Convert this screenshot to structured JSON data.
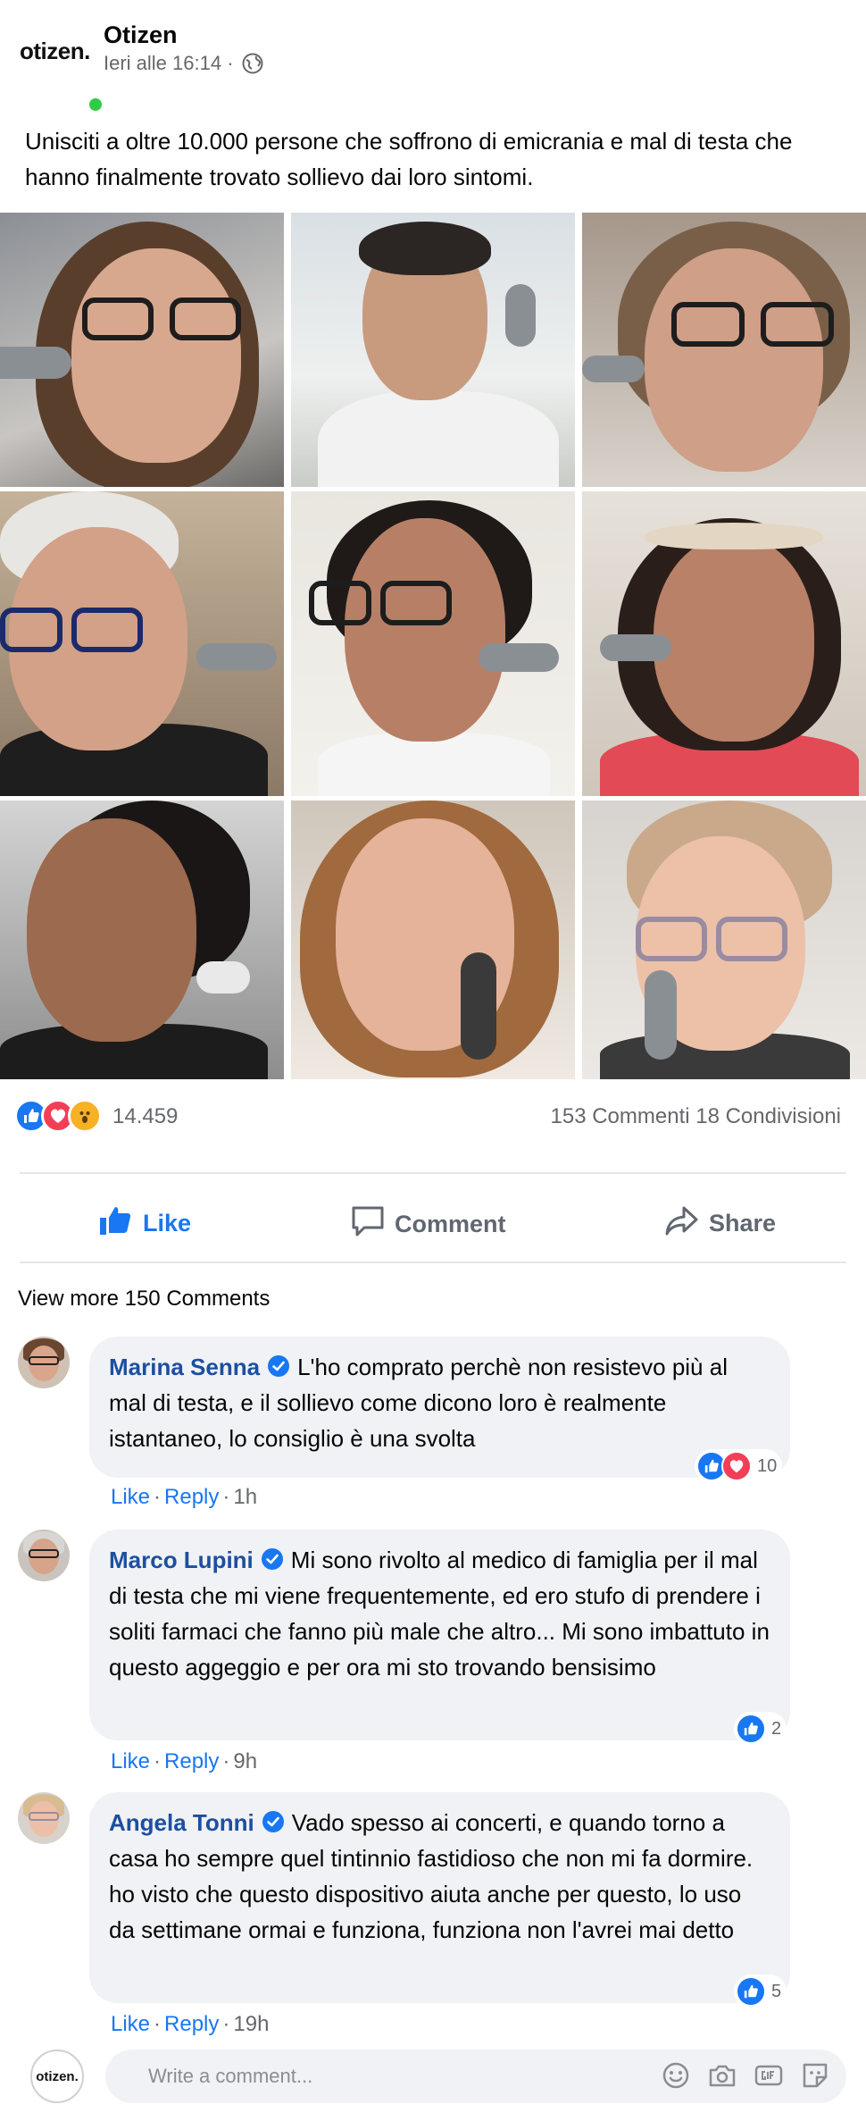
{
  "post": {
    "page_name": "Otizen",
    "logo_text": "otizen.",
    "timestamp": "Ieri alle 16:14 ·",
    "text": "Unisciti a oltre 10.000 persone che soffrono di emicrania e mal di testa che hanno finalmente trovato sollievo dai loro sintomi.",
    "photo_count": 9
  },
  "reactions": {
    "icons": [
      "like",
      "love",
      "wow"
    ],
    "count": "14.459",
    "comments_shares": "153 Commenti 18 Condivisioni"
  },
  "actions": {
    "like": "Like",
    "comment": "Comment",
    "share": "Share"
  },
  "view_more": "View more 150 Comments",
  "comments": [
    {
      "author": "Marina Senna",
      "text": "L'ho comprato perchè non resistevo più al mal di testa, e il sollievo come dicono loro è realmente istantaneo, lo consiglio è una svolta",
      "reactions": [
        "like",
        "love"
      ],
      "reaction_count": "10",
      "like": "Like",
      "reply": "Reply",
      "time": "1h"
    },
    {
      "author": "Marco Lupini",
      "text": "Mi sono rivolto al medico di famiglia per il mal di testa che mi viene frequentemente, ed ero stufo di prendere i soliti farmaci che fanno più male che altro... Mi sono imbattuto in questo aggeggio e per ora mi sto trovando bensisimo",
      "reactions": [
        "like"
      ],
      "reaction_count": "2",
      "like": "Like",
      "reply": "Reply",
      "time": "9h"
    },
    {
      "author": "Angela Tonni",
      "text": "Vado spesso ai concerti, e quando torno a casa ho sempre quel tintinnio fastidioso che non mi fa dormire. ho visto che questo dispositivo aiuta anche per questo, lo uso da settimane ormai e funziona, funziona non l'avrei mai detto",
      "reactions": [
        "like"
      ],
      "reaction_count": "5",
      "like": "Like",
      "reply": "Reply",
      "time": "19h"
    }
  ],
  "composer": {
    "avatar_text": "otizen.",
    "placeholder": "Write a comment...",
    "tools": [
      "emoji-icon",
      "camera-icon",
      "gif-icon",
      "sticker-icon"
    ]
  },
  "colors": {
    "accent": "#1877f2",
    "author": "#1d4fa0",
    "muted": "#65676b",
    "bubble": "#f0f2f5",
    "online": "#31cc46"
  }
}
